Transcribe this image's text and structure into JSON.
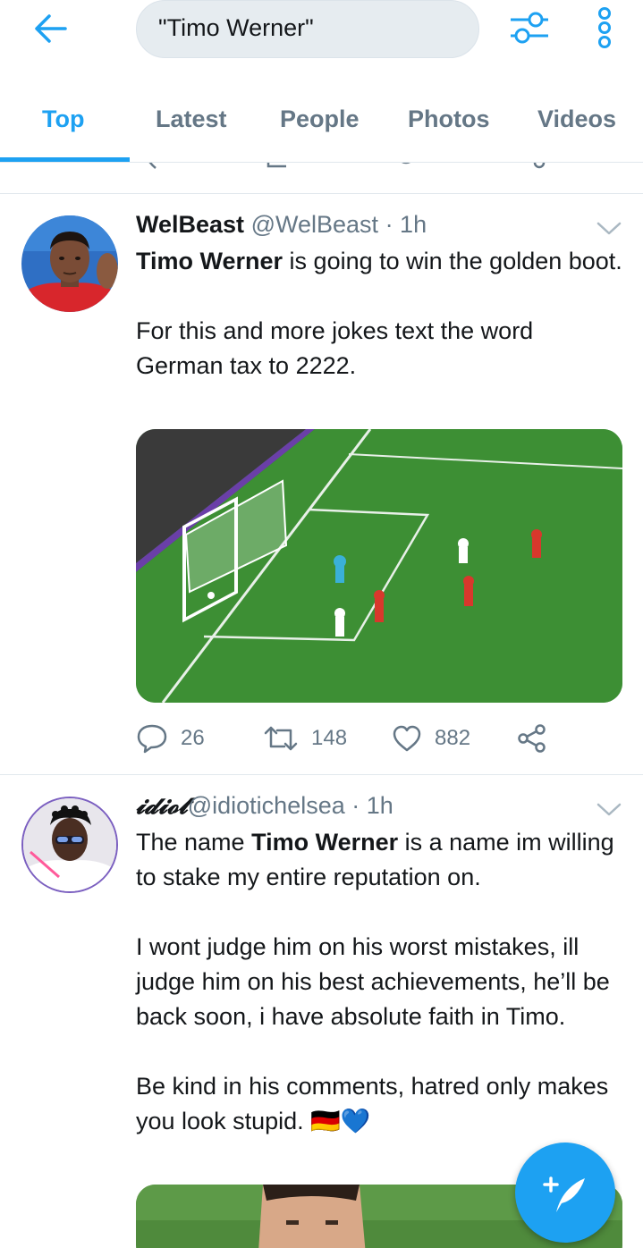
{
  "search": {
    "query": "\"Timo Werner\""
  },
  "tabs": [
    {
      "label": "Top",
      "active": true
    },
    {
      "label": "Latest",
      "active": false
    },
    {
      "label": "People",
      "active": false
    },
    {
      "label": "Photos",
      "active": false
    },
    {
      "label": "Videos",
      "active": false
    }
  ],
  "tweets": [
    {
      "display_name": "WelBeast",
      "handle": "@WelBeast",
      "time": "· 1h",
      "text_bold": "Timo Werner",
      "text_line1_rest": " is going to win the golden boot.",
      "text_para2": "For this and more jokes text the word German tax to 2222.",
      "media": "football-pitch-photo",
      "replies": "26",
      "retweets": "148",
      "likes": "882"
    },
    {
      "display_name": "𝓲𝓭𝓲𝓸𝓽",
      "handle": "@idiotichelsea",
      "time": "· 1h",
      "text_pre": "The name ",
      "text_bold": "Timo Werner",
      "text_post": " is a name im willing to stake my entire reputation on.",
      "text_para2": "I wont judge him on his worst mistakes, ill judge him on his best achievements, he’ll be back soon, i have absolute faith in Timo.",
      "text_para3": "Be kind in his comments, hatred only makes you look stupid. 🇩🇪💙",
      "media": "player-portrait-photo"
    }
  ],
  "colors": {
    "accent": "#1da1f2",
    "text_primary": "#14171a",
    "text_secondary": "#657786",
    "divider": "#e1e8ed"
  },
  "icons": [
    "back-arrow-icon",
    "filter-icon",
    "more-vertical-icon",
    "reply-icon",
    "retweet-icon",
    "like-icon",
    "share-icon",
    "caret-down-icon",
    "compose-icon"
  ]
}
